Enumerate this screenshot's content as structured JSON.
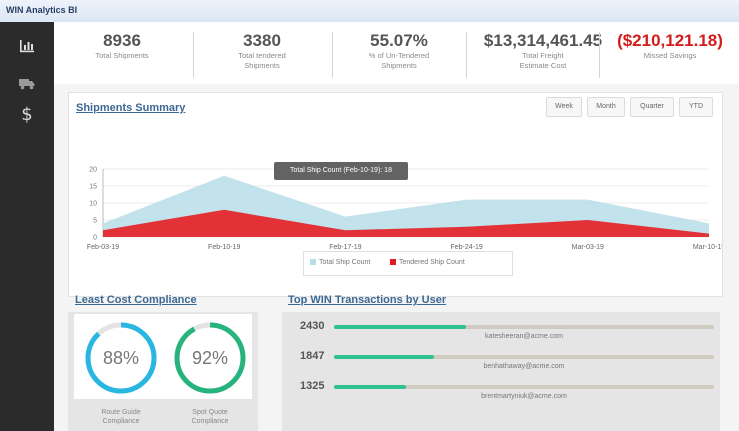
{
  "app": {
    "title": "WIN Analytics BI"
  },
  "sidebar": {
    "items": [
      {
        "icon": "bar-chart-icon",
        "active": true
      },
      {
        "icon": "truck-icon",
        "active": false
      },
      {
        "icon": "dollar-icon",
        "label": "$",
        "active": false
      }
    ]
  },
  "kpis": [
    {
      "value": "8936",
      "label_lines": [
        "Total Shipments"
      ]
    },
    {
      "value": "3380",
      "label_lines": [
        "Total tendered",
        "Shipments"
      ]
    },
    {
      "value": "55.07%",
      "label_lines": [
        "% of Un-Tendered",
        "Shipments"
      ]
    },
    {
      "value": "$13,314,461.45",
      "label_lines": [
        "Total Freight",
        "Estimate Cost"
      ]
    },
    {
      "value": "($210,121.18)",
      "label_lines": [
        "Missed Savings"
      ]
    }
  ],
  "summary": {
    "title": "Shipments Summary",
    "tabs": [
      "Week",
      "Month",
      "Quarter",
      "YTD"
    ],
    "tooltip": "Total Ship Count (Feb-10-19): 18",
    "legend": [
      "Total Ship Count",
      "Tendered Ship Count"
    ],
    "colors": {
      "total": "#b7dde9",
      "tendered": "#e23237"
    }
  },
  "chart_data": {
    "type": "area",
    "categories": [
      "Feb-03-19",
      "Feb-10-19",
      "Feb-17-19",
      "Feb-24-19",
      "Mar-03-19",
      "Mar-10-19"
    ],
    "yticks": [
      0,
      5,
      10,
      15,
      20
    ],
    "ylim": [
      0,
      20
    ],
    "grid": true,
    "legend_position": "bottom",
    "series": [
      {
        "name": "Total Ship Count",
        "values": [
          4,
          18,
          6,
          11,
          11,
          4
        ]
      },
      {
        "name": "Tendered Ship Count",
        "values": [
          2,
          8,
          2,
          3,
          5,
          1
        ]
      }
    ]
  },
  "compliance": {
    "title": "Least Cost Compliance",
    "gauges": [
      {
        "value": 0.88,
        "text": "88%",
        "label_lines": [
          "Route Guide",
          "Compliance"
        ],
        "color": "#29b6e0"
      },
      {
        "value": 0.92,
        "text": "92%",
        "label_lines": [
          "Spot Quote",
          "Compliance"
        ],
        "color": "#27b37e"
      }
    ]
  },
  "top_win": {
    "title": "Top WIN Transactions by User",
    "max": 7000,
    "rows": [
      {
        "count": "2430",
        "value": 2430,
        "email": "katesheeran@acme.com"
      },
      {
        "count": "1847",
        "value": 1847,
        "email": "benhathaway@acme.com"
      },
      {
        "count": "1325",
        "value": 1325,
        "email": "brentmartyniuk@acme.com"
      }
    ]
  }
}
